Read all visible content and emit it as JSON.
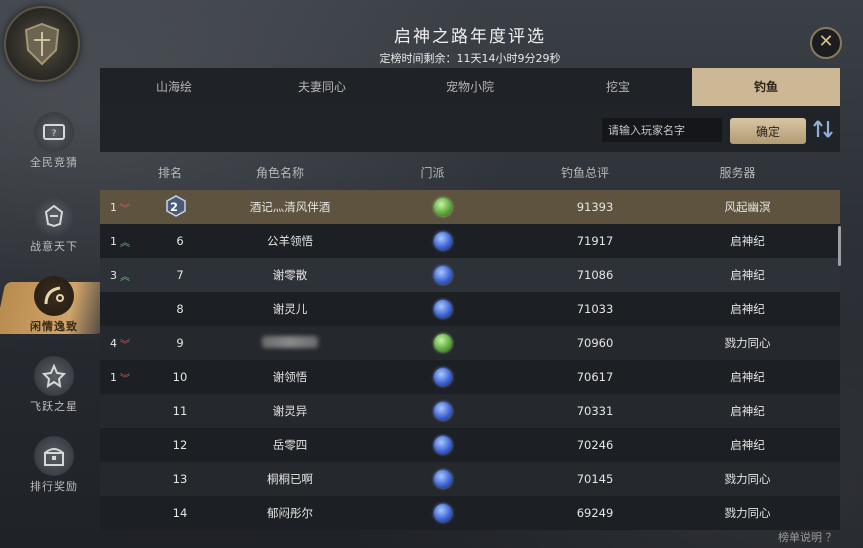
{
  "header": {
    "title": "启神之路年度评选",
    "countdown": "定榜时间剩余：11天14小时9分29秒"
  },
  "sidebar": {
    "items": [
      {
        "label": "全民竞猜",
        "icon": "ticket-icon"
      },
      {
        "label": "战意天下",
        "icon": "helmet-icon"
      },
      {
        "label": "闲情逸致",
        "icon": "fishing-rod-icon"
      },
      {
        "label": "飞跃之星",
        "icon": "star-icon"
      },
      {
        "label": "排行奖励",
        "icon": "chest-icon"
      }
    ]
  },
  "tabs": [
    "山海绘",
    "夫妻同心",
    "宠物小院",
    "挖宝",
    "钓鱼"
  ],
  "search": {
    "placeholder": "请输入玩家名字",
    "confirm_label": "确定"
  },
  "table": {
    "headers": [
      "排名",
      "角色名称",
      "门派",
      "钓鱼总评",
      "服务器"
    ],
    "rows": [
      {
        "change": "1",
        "dir": "down",
        "rank": "2",
        "name": "酒记灬清风伴酒",
        "faction": "green",
        "score": "91393",
        "server": "风起幽溟"
      },
      {
        "change": "1",
        "dir": "up",
        "rank": "6",
        "name": "公羊领悟",
        "faction": "blue",
        "score": "71917",
        "server": "启神纪"
      },
      {
        "change": "3",
        "dir": "up",
        "rank": "7",
        "name": "谢零散",
        "faction": "blue",
        "score": "71086",
        "server": "启神纪"
      },
      {
        "change": "",
        "dir": "",
        "rank": "8",
        "name": "谢灵儿",
        "faction": "blue",
        "score": "71033",
        "server": "启神纪"
      },
      {
        "change": "4",
        "dir": "down",
        "rank": "9",
        "name": "",
        "faction": "green",
        "score": "70960",
        "server": "戮力同心"
      },
      {
        "change": "1",
        "dir": "down",
        "rank": "10",
        "name": "谢领悟",
        "faction": "blue",
        "score": "70617",
        "server": "启神纪"
      },
      {
        "change": "",
        "dir": "",
        "rank": "11",
        "name": "谢灵异",
        "faction": "blue",
        "score": "70331",
        "server": "启神纪"
      },
      {
        "change": "",
        "dir": "",
        "rank": "12",
        "name": "岳零四",
        "faction": "blue",
        "score": "70246",
        "server": "启神纪"
      },
      {
        "change": "",
        "dir": "",
        "rank": "13",
        "name": "桐桐已啊",
        "faction": "blue",
        "score": "70145",
        "server": "戮力同心"
      },
      {
        "change": "",
        "dir": "",
        "rank": "14",
        "name": "郁闷彤尔",
        "faction": "blue",
        "score": "69249",
        "server": "戮力同心"
      }
    ]
  },
  "footer": {
    "help_label": "榜单说明 ？"
  }
}
